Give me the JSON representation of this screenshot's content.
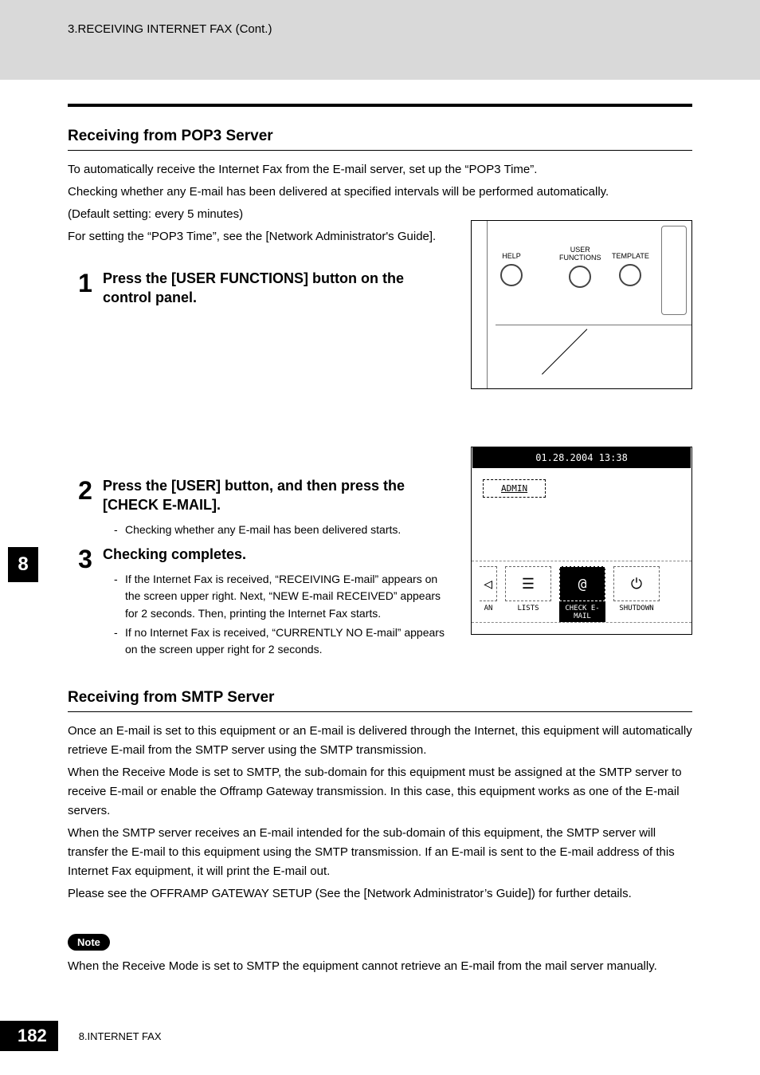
{
  "header": {
    "breadcrumb": "3.RECEIVING INTERNET FAX (Cont.)"
  },
  "chapter_tab": "8",
  "sections": {
    "pop3": {
      "title": "Receiving from POP3 Server",
      "paragraphs": [
        "To automatically receive the Internet Fax from the E-mail server, set up the “POP3 Time”.",
        "Checking whether any E-mail has been delivered at specified intervals will be performed automatically.",
        "(Default setting: every 5 minutes)",
        "For setting the “POP3 Time”, see the [Network Administrator's Guide]."
      ],
      "steps": [
        {
          "num": "1",
          "title": "Press the [USER FUNCTIONS] button on the control panel."
        },
        {
          "num": "2",
          "title": "Press the [USER] button, and then press the [CHECK E-MAIL].",
          "bullets": [
            "Checking whether any E-mail has been delivered starts."
          ]
        },
        {
          "num": "3",
          "title": "Checking completes.",
          "bullets": [
            "If the Internet Fax is received, “RECEIVING E-mail” appears on the screen upper right. Next, “NEW E-mail RECEIVED” appears for 2 seconds. Then, printing the Internet Fax starts.",
            "If no Internet Fax is received, “CURRENTLY NO E-mail” appears on the screen upper right for 2 seconds."
          ]
        }
      ]
    },
    "smtp": {
      "title": "Receiving from SMTP Server",
      "paragraphs": [
        "Once an E-mail is set to this equipment or an E-mail is delivered through the Internet, this equipment will automatically retrieve E-mail from the SMTP server using the SMTP transmission.",
        "When the Receive Mode is set to SMTP, the sub-domain for this equipment must be assigned at the SMTP server to receive E-mail or enable the Offramp Gateway transmission. In this case, this equipment works as one of the E-mail servers.",
        "When the SMTP server receives an E-mail intended for the sub-domain of this equipment, the SMTP server will transfer the E-mail to this equipment using the SMTP transmission. If an E-mail is sent to the E-mail address of this Internet Fax equipment, it will print the E-mail out.",
        "Please see the OFFRAMP GATEWAY SETUP (See the [Network Administrator’s Guide]) for further details."
      ],
      "note_label": "Note",
      "note_text": "When the Receive Mode is set to SMTP the equipment cannot retrieve an E-mail from the mail server manually."
    }
  },
  "panel": {
    "help": "HELP",
    "user_functions": "USER\nFUNCTIONS",
    "template": "TEMPLATE"
  },
  "lcd": {
    "datetime": "01.28.2004 13:38",
    "tab": "ADMIN",
    "btn_an": "AN",
    "btn_lists": "LISTS",
    "btn_check": "CHECK E-MAIL",
    "btn_shutdown": "SHUTDOWN"
  },
  "footer": {
    "page": "182",
    "chapter": "8.INTERNET FAX"
  }
}
